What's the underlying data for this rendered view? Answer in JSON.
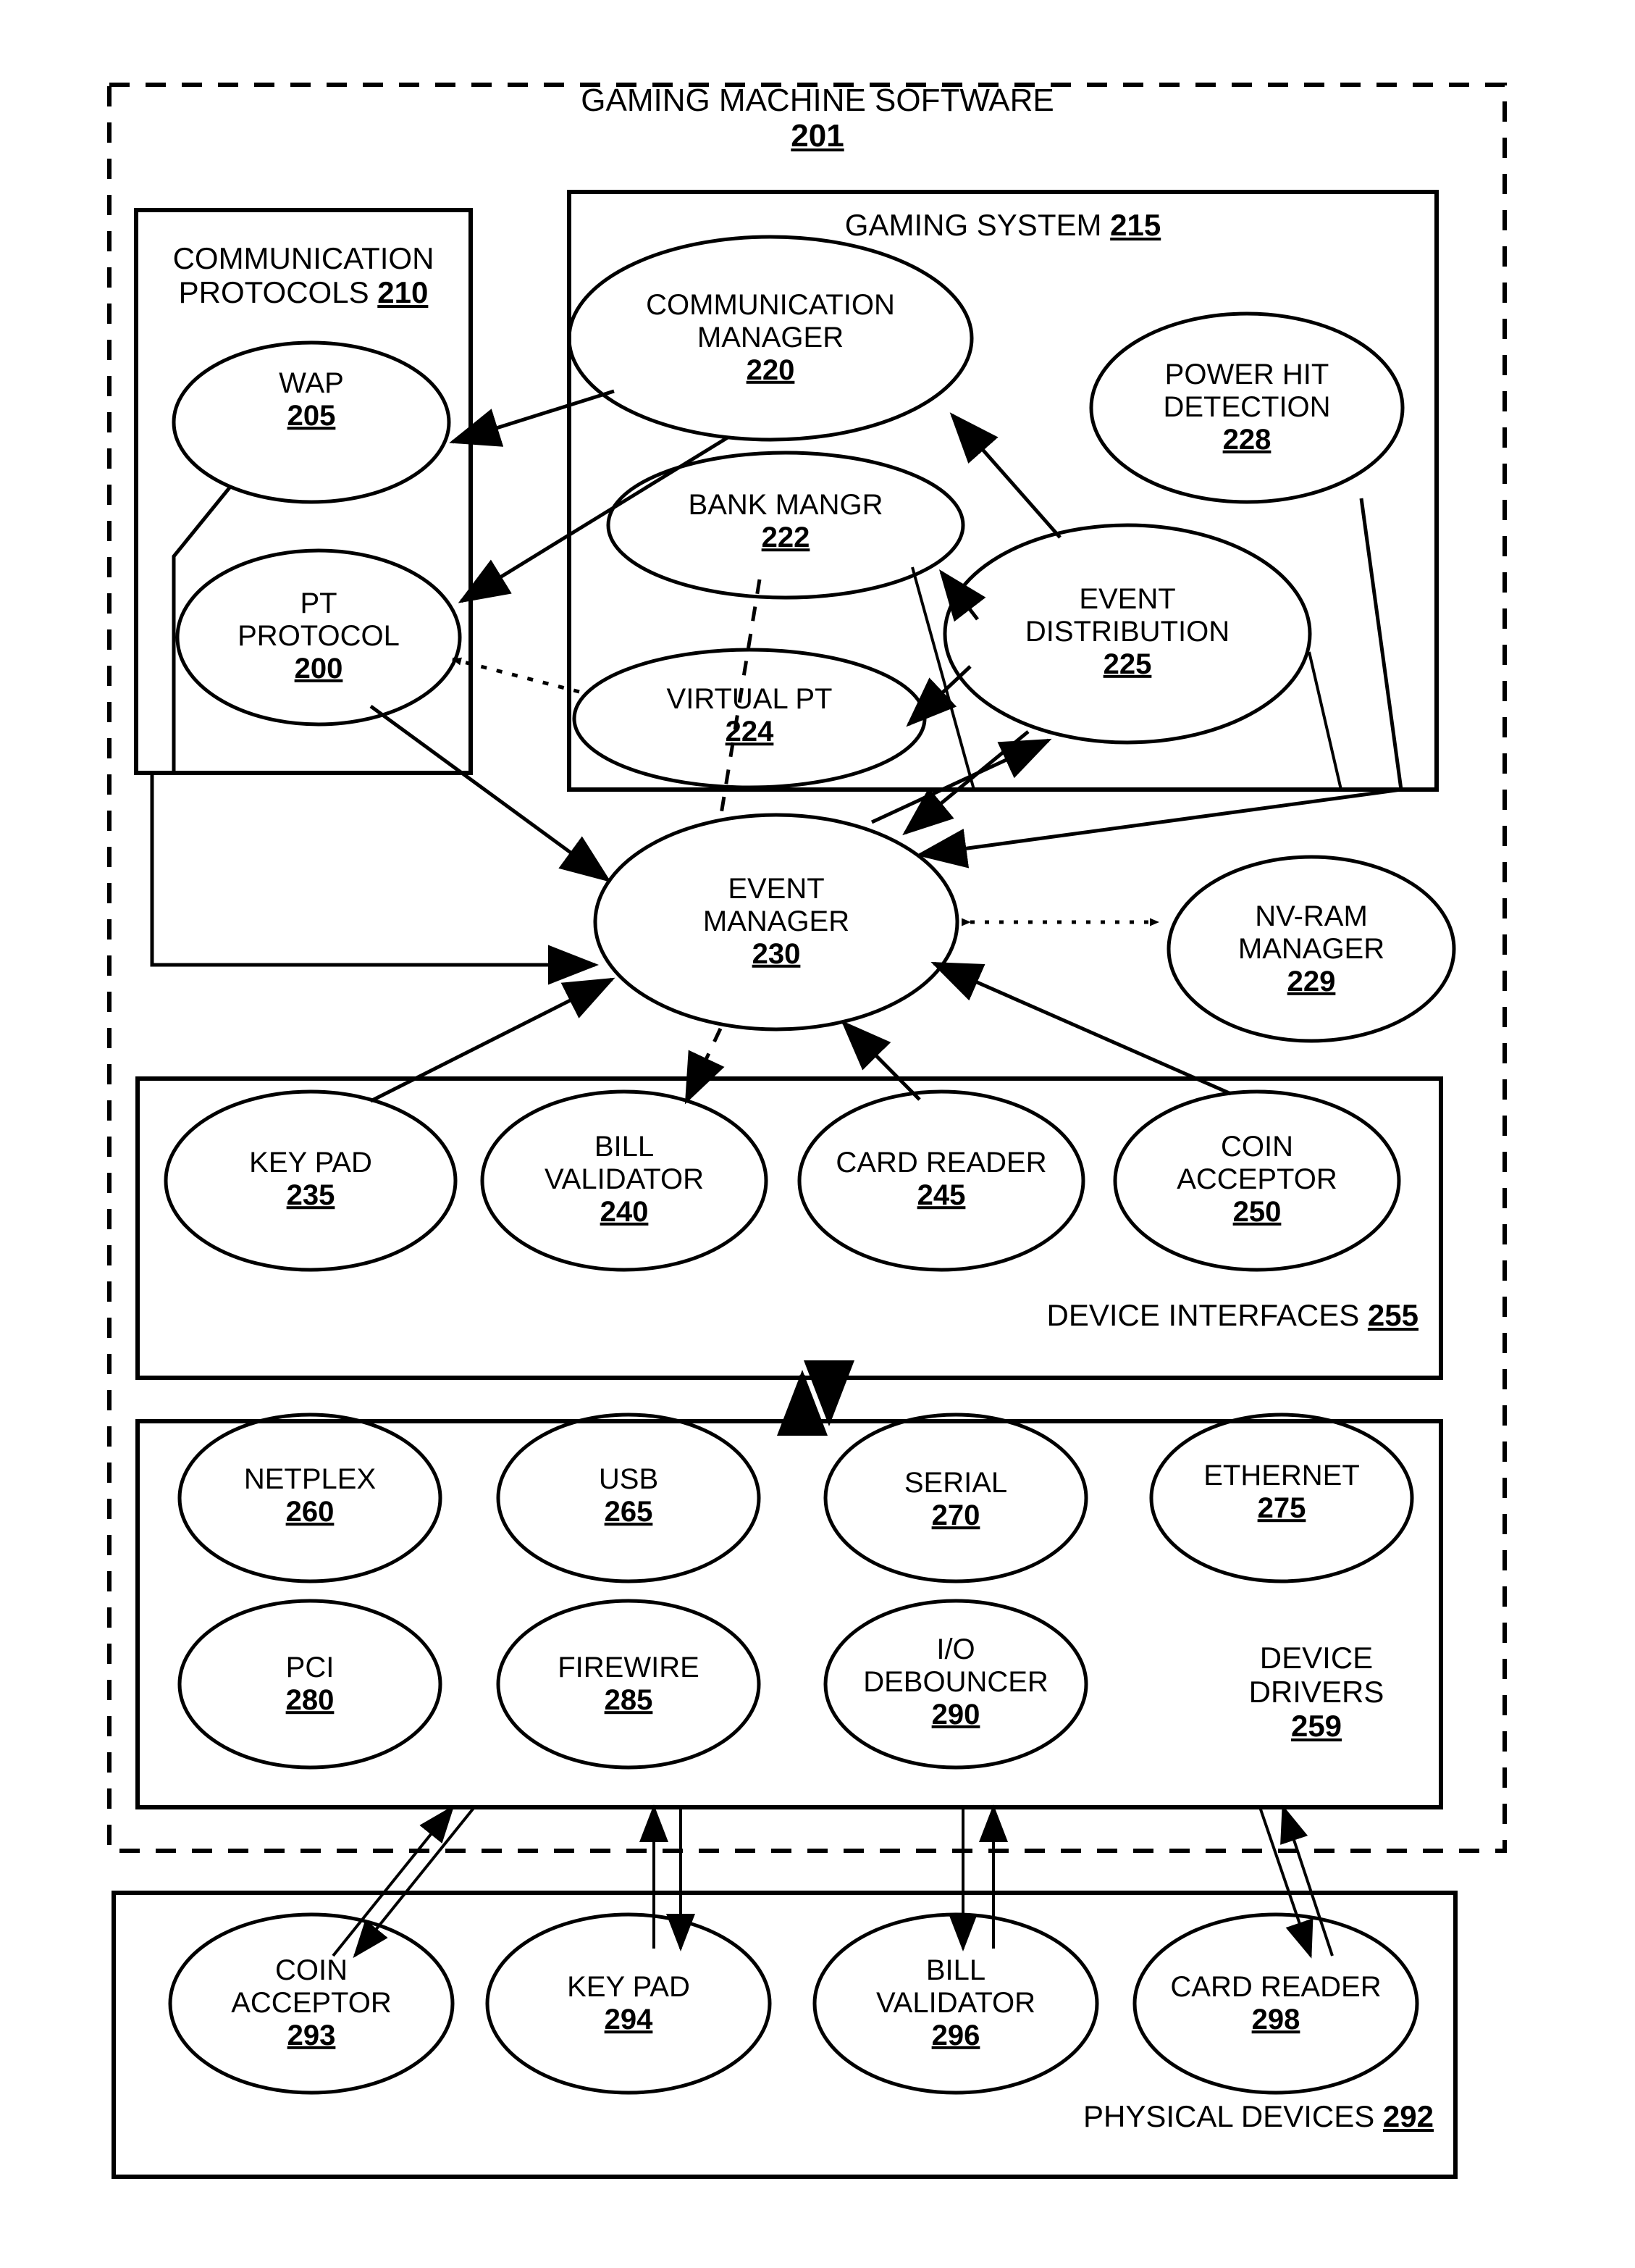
{
  "figure": {
    "outer_label": "GAMING MACHINE SOFTWARE",
    "outer_num": "201"
  },
  "containers": [
    {
      "id": "comm-protocols",
      "line1": "COMMUNICATION",
      "line2": "PROTOCOLS",
      "num": "210"
    },
    {
      "id": "gaming-system",
      "line1": "GAMING SYSTEM",
      "num": "215"
    },
    {
      "id": "device-interfaces",
      "line1": "DEVICE INTERFACES",
      "num": "255"
    },
    {
      "id": "device-drivers",
      "line1": "DEVICE",
      "line2": "DRIVERS",
      "num": "259"
    },
    {
      "id": "physical-devices",
      "line1": "PHYSICAL DEVICES",
      "num": "292"
    }
  ],
  "nodes": {
    "wap": {
      "line1": "WAP",
      "num": "205"
    },
    "pt_protocol": {
      "line1": "PT",
      "line2": "PROTOCOL",
      "num": "200"
    },
    "comm_manager": {
      "line1": "COMMUNICATION",
      "line2": "MANAGER",
      "num": "220"
    },
    "power_hit": {
      "line1": "POWER HIT",
      "line2": "DETECTION",
      "num": "228"
    },
    "bank_mangr": {
      "line1": "BANK MANGR",
      "num": "222"
    },
    "event_dist": {
      "line1": "EVENT",
      "line2": "DISTRIBUTION",
      "num": "225"
    },
    "virtual_pt": {
      "line1": "VIRTUAL PT",
      "num": "224"
    },
    "event_manager": {
      "line1": "EVENT",
      "line2": "MANAGER",
      "num": "230"
    },
    "nvram_manager": {
      "line1": "NV-RAM",
      "line2": "MANAGER",
      "num": "229"
    },
    "key_pad_if": {
      "line1": "KEY PAD",
      "num": "235"
    },
    "bill_val_if": {
      "line1": "BILL",
      "line2": "VALIDATOR",
      "num": "240"
    },
    "card_reader_if": {
      "line1": "CARD READER",
      "num": "245"
    },
    "coin_acc_if": {
      "line1": "COIN",
      "line2": "ACCEPTOR",
      "num": "250"
    },
    "netplex": {
      "line1": "NETPLEX",
      "num": "260"
    },
    "usb": {
      "line1": "USB",
      "num": "265"
    },
    "serial": {
      "line1": "SERIAL",
      "num": "270"
    },
    "ethernet": {
      "line1": "ETHERNET",
      "num": "275"
    },
    "pci": {
      "line1": "PCI",
      "num": "280"
    },
    "firewire": {
      "line1": "FIREWIRE",
      "num": "285"
    },
    "io_debouncer": {
      "line1": "I/O",
      "line2": "DEBOUNCER",
      "num": "290"
    },
    "coin_acc_phys": {
      "line1": "COIN",
      "line2": "ACCEPTOR",
      "num": "293"
    },
    "key_pad_phys": {
      "line1": "KEY PAD",
      "num": "294"
    },
    "bill_val_phys": {
      "line1": "BILL",
      "line2": "VALIDATOR",
      "num": "296"
    },
    "card_reader_phys": {
      "line1": "CARD READER",
      "num": "298"
    }
  },
  "colors": {
    "stroke": "#000000",
    "background": "#ffffff"
  }
}
